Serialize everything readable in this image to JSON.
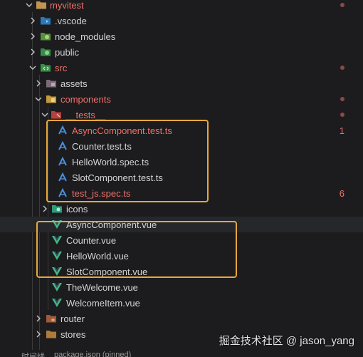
{
  "explorer": {
    "items": [
      {
        "label": "myvitest",
        "icon": "folder-open-icon",
        "chevron": "down",
        "modified": true
      },
      {
        "label": ".vscode",
        "icon": "vscode-folder-icon",
        "chevron": "right"
      },
      {
        "label": "node_modules",
        "icon": "node-folder-icon",
        "chevron": "right"
      },
      {
        "label": "public",
        "icon": "public-folder-icon",
        "chevron": "right"
      },
      {
        "label": "src",
        "icon": "src-folder-icon",
        "chevron": "down",
        "modified": true
      },
      {
        "label": "assets",
        "icon": "assets-folder-icon",
        "chevron": "right"
      },
      {
        "label": "components",
        "icon": "components-folder-icon",
        "chevron": "down",
        "modified": true
      },
      {
        "label": "__tests__",
        "icon": "tests-folder-icon",
        "chevron": "down",
        "modified": true
      },
      {
        "label": "AsyncComponent.test.ts",
        "icon": "test-ts-file-icon",
        "problems": "1"
      },
      {
        "label": "Counter.test.ts",
        "icon": "test-ts-file-icon"
      },
      {
        "label": "HelloWorld.spec.ts",
        "icon": "test-ts-file-icon"
      },
      {
        "label": "SlotComponent.test.ts",
        "icon": "test-ts-file-icon"
      },
      {
        "label": "test_js.spec.ts",
        "icon": "test-ts-file-icon",
        "problems": "6"
      },
      {
        "label": "icons",
        "icon": "icons-folder-icon",
        "chevron": "right"
      },
      {
        "label": "AsyncComponent.vue",
        "icon": "vue-file-icon"
      },
      {
        "label": "Counter.vue",
        "icon": "vue-file-icon"
      },
      {
        "label": "HelloWorld.vue",
        "icon": "vue-file-icon"
      },
      {
        "label": "SlotComponent.vue",
        "icon": "vue-file-icon"
      },
      {
        "label": "TheWelcome.vue",
        "icon": "vue-file-icon"
      },
      {
        "label": "WelcomeItem.vue",
        "icon": "vue-file-icon"
      },
      {
        "label": "router",
        "icon": "router-folder-icon",
        "chevron": "right"
      },
      {
        "label": "stores",
        "icon": "stores-folder-icon",
        "chevron": "right"
      }
    ]
  },
  "watermark": "掘金技术社区 @ jason_yang",
  "bottom": {
    "label": "时间线",
    "pinned": "package.json (pinned)"
  },
  "colors": {
    "background": "#1c1c1e",
    "modified": "#f0706a",
    "highlight_box": "#e8a83a",
    "vue_green": "#41b883",
    "ts_blue": "#3178c6"
  }
}
